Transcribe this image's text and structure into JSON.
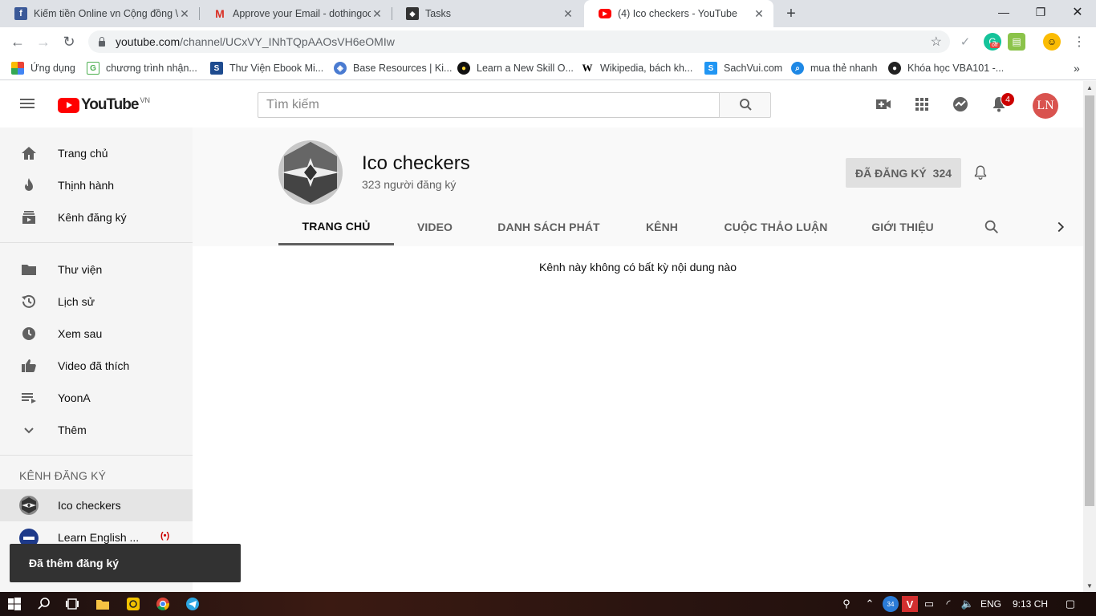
{
  "browser": {
    "tabs": [
      {
        "title": "Kiếm tiền Online vn Cộng đồng \\",
        "favicon": "facebook-icon",
        "active": false
      },
      {
        "title": "Approve your Email - dothingoc",
        "favicon": "gmail-icon",
        "active": false
      },
      {
        "title": "Tasks",
        "favicon": "tasks-icon",
        "active": false
      },
      {
        "title": "(4) Ico checkers - YouTube",
        "favicon": "youtube-icon",
        "active": true
      }
    ],
    "url_host": "youtube.com",
    "url_path": "/channel/UCxVY_INhTQpAAOsVH6eOMIw",
    "extension_badge": "off",
    "bookmarks": [
      {
        "label": "Ứng dụng",
        "icon": "apps-grid-icon"
      },
      {
        "label": "chương trình nhận...",
        "icon": "bookmark-gb-icon"
      },
      {
        "label": "Thư Viện Ebook Mi...",
        "icon": "bookmark-s-icon"
      },
      {
        "label": "Base Resources | Ki...",
        "icon": "bookmark-shield-icon"
      },
      {
        "label": "Learn a New Skill O...",
        "icon": "bookmark-lynda-icon"
      },
      {
        "label": "Wikipedia, bách kh...",
        "icon": "wikipedia-icon"
      },
      {
        "label": "SachVui.com",
        "icon": "bookmark-sachvui-icon"
      },
      {
        "label": "mua thẻ nhanh",
        "icon": "bookmark-search-icon"
      },
      {
        "label": "Khóa học VBA101 -...",
        "icon": "bookmark-vba-icon"
      }
    ]
  },
  "youtube": {
    "logo_text": "YouTube",
    "logo_country": "VN",
    "search_placeholder": "Tìm kiếm",
    "notification_count": "4",
    "avatar_initials": "LN",
    "sidebar": {
      "main": [
        {
          "label": "Trang chủ",
          "icon": "home-icon"
        },
        {
          "label": "Thịnh hành",
          "icon": "trending-icon"
        },
        {
          "label": "Kênh đăng ký",
          "icon": "subscriptions-icon"
        }
      ],
      "library": [
        {
          "label": "Thư viện",
          "icon": "library-icon"
        },
        {
          "label": "Lịch sử",
          "icon": "history-icon"
        },
        {
          "label": "Xem sau",
          "icon": "watch-later-icon"
        },
        {
          "label": "Video đã thích",
          "icon": "thumbs-up-icon"
        },
        {
          "label": "YoonA",
          "icon": "playlist-icon"
        },
        {
          "label": "Thêm",
          "icon": "chevron-down-icon"
        }
      ],
      "subscriptions_title": "KÊNH ĐĂNG KÝ",
      "subscriptions": [
        {
          "label": "Ico checkers",
          "active": true
        },
        {
          "label": "Learn English ...",
          "live": true
        }
      ]
    },
    "channel": {
      "name": "Ico checkers",
      "subscribers": "323 người đăng ký",
      "subscribe_label": "ĐÃ ĐĂNG KÝ",
      "subscribe_count": "324",
      "tabs": [
        "TRANG CHỦ",
        "VIDEO",
        "DANH SÁCH PHÁT",
        "KÊNH",
        "CUỘC THẢO LUẬN",
        "GIỚI THIỆU"
      ],
      "active_tab": "TRANG CHỦ",
      "empty_message": "Kênh này không có bất kỳ nội dung nào"
    },
    "toast": "Đã thêm đăng ký"
  },
  "taskbar": {
    "language": "ENG",
    "time": "9:13 CH",
    "tray_badge": "34"
  }
}
